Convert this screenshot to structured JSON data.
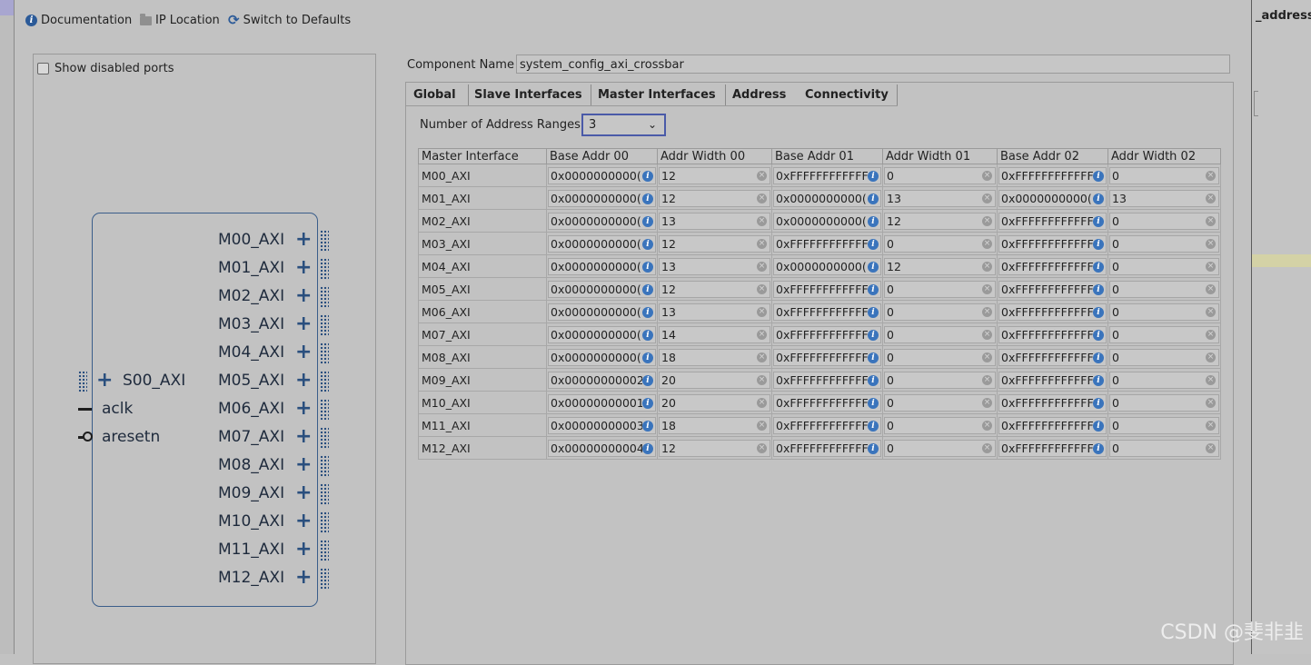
{
  "toolbar": {
    "documentation": "Documentation",
    "ip_location": "IP Location",
    "switch_defaults": "Switch to Defaults"
  },
  "left_panel": {
    "show_disabled_ports": "Show disabled ports"
  },
  "ip_block": {
    "slave_port": "S00_AXI",
    "clock_port": "aclk",
    "reset_port": "aresetn",
    "master_ports": [
      "M00_AXI",
      "M01_AXI",
      "M02_AXI",
      "M03_AXI",
      "M04_AXI",
      "M05_AXI",
      "M06_AXI",
      "M07_AXI",
      "M08_AXI",
      "M09_AXI",
      "M10_AXI",
      "M11_AXI",
      "M12_AXI"
    ]
  },
  "component": {
    "label": "Component Name",
    "value": "system_config_axi_crossbar"
  },
  "tabs": [
    "Global",
    "Slave Interfaces",
    "Master Interfaces",
    "Address",
    "Connectivity"
  ],
  "address": {
    "num_ranges_label": "Number of Address Ranges",
    "num_ranges_value": "3",
    "columns": [
      "Master Interface",
      "Base Addr 00",
      "Addr Width 00",
      "Base Addr 01",
      "Addr Width 01",
      "Base Addr 02",
      "Addr Width 02"
    ],
    "rows": [
      [
        "M00_AXI",
        "0x0000000000(",
        "12",
        "0xFFFFFFFFFFFF",
        "0",
        "0xFFFFFFFFFFFF",
        "0"
      ],
      [
        "M01_AXI",
        "0x0000000000(",
        "12",
        "0x0000000000(",
        "13",
        "0x0000000000(",
        "13"
      ],
      [
        "M02_AXI",
        "0x0000000000(",
        "13",
        "0x0000000000(",
        "12",
        "0xFFFFFFFFFFFF",
        "0"
      ],
      [
        "M03_AXI",
        "0x0000000000(",
        "12",
        "0xFFFFFFFFFFFF",
        "0",
        "0xFFFFFFFFFFFF",
        "0"
      ],
      [
        "M04_AXI",
        "0x0000000000(",
        "13",
        "0x0000000000(",
        "12",
        "0xFFFFFFFFFFFF",
        "0"
      ],
      [
        "M05_AXI",
        "0x0000000000(",
        "12",
        "0xFFFFFFFFFFFF",
        "0",
        "0xFFFFFFFFFFFF",
        "0"
      ],
      [
        "M06_AXI",
        "0x0000000000(",
        "13",
        "0xFFFFFFFFFFFF",
        "0",
        "0xFFFFFFFFFFFF",
        "0"
      ],
      [
        "M07_AXI",
        "0x0000000000(",
        "14",
        "0xFFFFFFFFFFFF",
        "0",
        "0xFFFFFFFFFFFF",
        "0"
      ],
      [
        "M08_AXI",
        "0x0000000000(",
        "18",
        "0xFFFFFFFFFFFF",
        "0",
        "0xFFFFFFFFFFFF",
        "0"
      ],
      [
        "M09_AXI",
        "0x00000000002",
        "20",
        "0xFFFFFFFFFFFF",
        "0",
        "0xFFFFFFFFFFFF",
        "0"
      ],
      [
        "M10_AXI",
        "0x00000000001",
        "20",
        "0xFFFFFFFFFFFF",
        "0",
        "0xFFFFFFFFFFFF",
        "0"
      ],
      [
        "M11_AXI",
        "0x00000000003",
        "18",
        "0xFFFFFFFFFFFF",
        "0",
        "0xFFFFFFFFFFFF",
        "0"
      ],
      [
        "M12_AXI",
        "0x00000000004",
        "12",
        "0xFFFFFFFFFFFF",
        "0",
        "0xFFFFFFFFFFFF",
        "0"
      ]
    ]
  },
  "right_strip": {
    "label": "_address_"
  },
  "watermark": "CSDN @斐非韭"
}
